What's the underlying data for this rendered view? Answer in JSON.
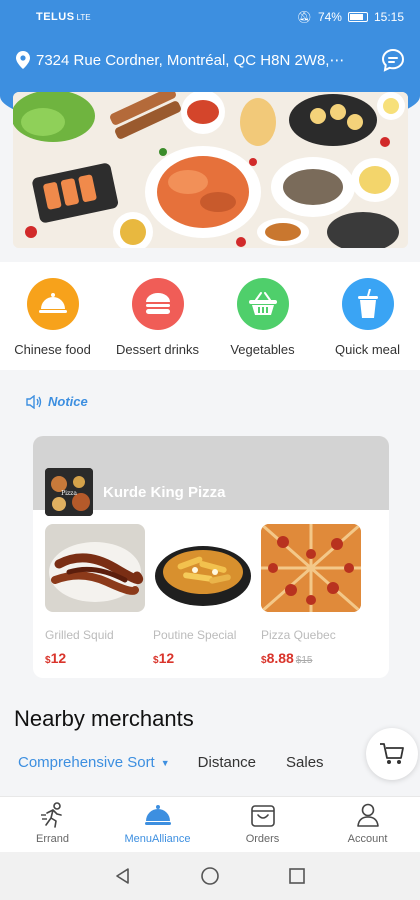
{
  "status_bar": {
    "carrier": "TELUS",
    "network": "LTE",
    "battery": "74%",
    "time": "15:15"
  },
  "header": {
    "address": "7324 Rue Cordner, Montréal, QC H8N 2W8,⋯"
  },
  "categories": [
    {
      "label": "Chinese food",
      "color": "#f7a21b",
      "icon": "cloche-icon"
    },
    {
      "label": "Dessert drinks",
      "color": "#f05d57",
      "icon": "burger-icon"
    },
    {
      "label": "Vegetables",
      "color": "#4fcf6b",
      "icon": "basket-icon"
    },
    {
      "label": "Quick meal",
      "color": "#3aa4f4",
      "icon": "drink-cup-icon"
    }
  ],
  "notice": {
    "label": "Notice"
  },
  "shop": {
    "name": "Kurde King Pizza",
    "dishes": [
      {
        "name": "Grilled Squid",
        "currency": "$",
        "price": "12",
        "old_price": ""
      },
      {
        "name": "Poutine Special",
        "currency": "$",
        "price": "12",
        "old_price": ""
      },
      {
        "name": "Pizza Quebec",
        "currency": "$",
        "price": "8.88",
        "old_price": "$15"
      }
    ]
  },
  "nearby": {
    "title": "Nearby merchants",
    "sort_options": [
      "Comprehensive Sort",
      "Distance",
      "Sales"
    ]
  },
  "tabs": [
    {
      "label": "Errand",
      "icon": "runner-icon"
    },
    {
      "label": "MenuAlliance",
      "icon": "cloche-icon",
      "active": true
    },
    {
      "label": "Orders",
      "icon": "shopping-bag-icon"
    },
    {
      "label": "Account",
      "icon": "person-icon"
    }
  ],
  "colors": {
    "primary": "#3d8fe0",
    "price": "#d9342b"
  }
}
